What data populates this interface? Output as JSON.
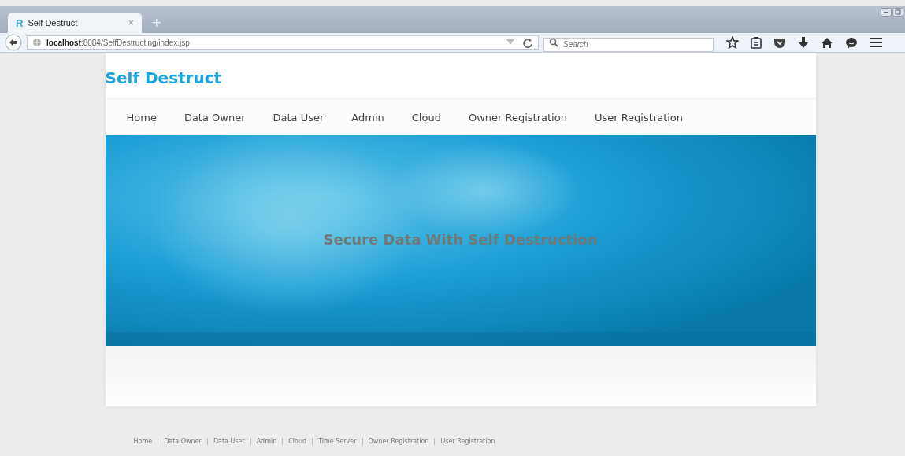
{
  "browser": {
    "tab": {
      "icon_letter": "R",
      "title": "Self Destruct",
      "close": "×",
      "new_tab": "+"
    },
    "address": {
      "host": "localhost",
      "path": ":8084/SelfDestructing/index.jsp"
    },
    "search": {
      "placeholder": "Search"
    }
  },
  "site": {
    "title": "Self Destruct",
    "nav": [
      {
        "label": "Home"
      },
      {
        "label": "Data Owner"
      },
      {
        "label": "Data User"
      },
      {
        "label": "Admin"
      },
      {
        "label": "Cloud"
      },
      {
        "label": "Owner Registration"
      },
      {
        "label": "User Registration"
      }
    ],
    "banner": {
      "heading": "Secure Data With Self Destruction"
    },
    "footer": [
      {
        "label": "Home"
      },
      {
        "label": "Data Owner"
      },
      {
        "label": "Data User"
      },
      {
        "label": "Admin"
      },
      {
        "label": "Cloud"
      },
      {
        "label": "Time Server"
      },
      {
        "label": "Owner Registration"
      },
      {
        "label": "User Registration"
      }
    ]
  }
}
